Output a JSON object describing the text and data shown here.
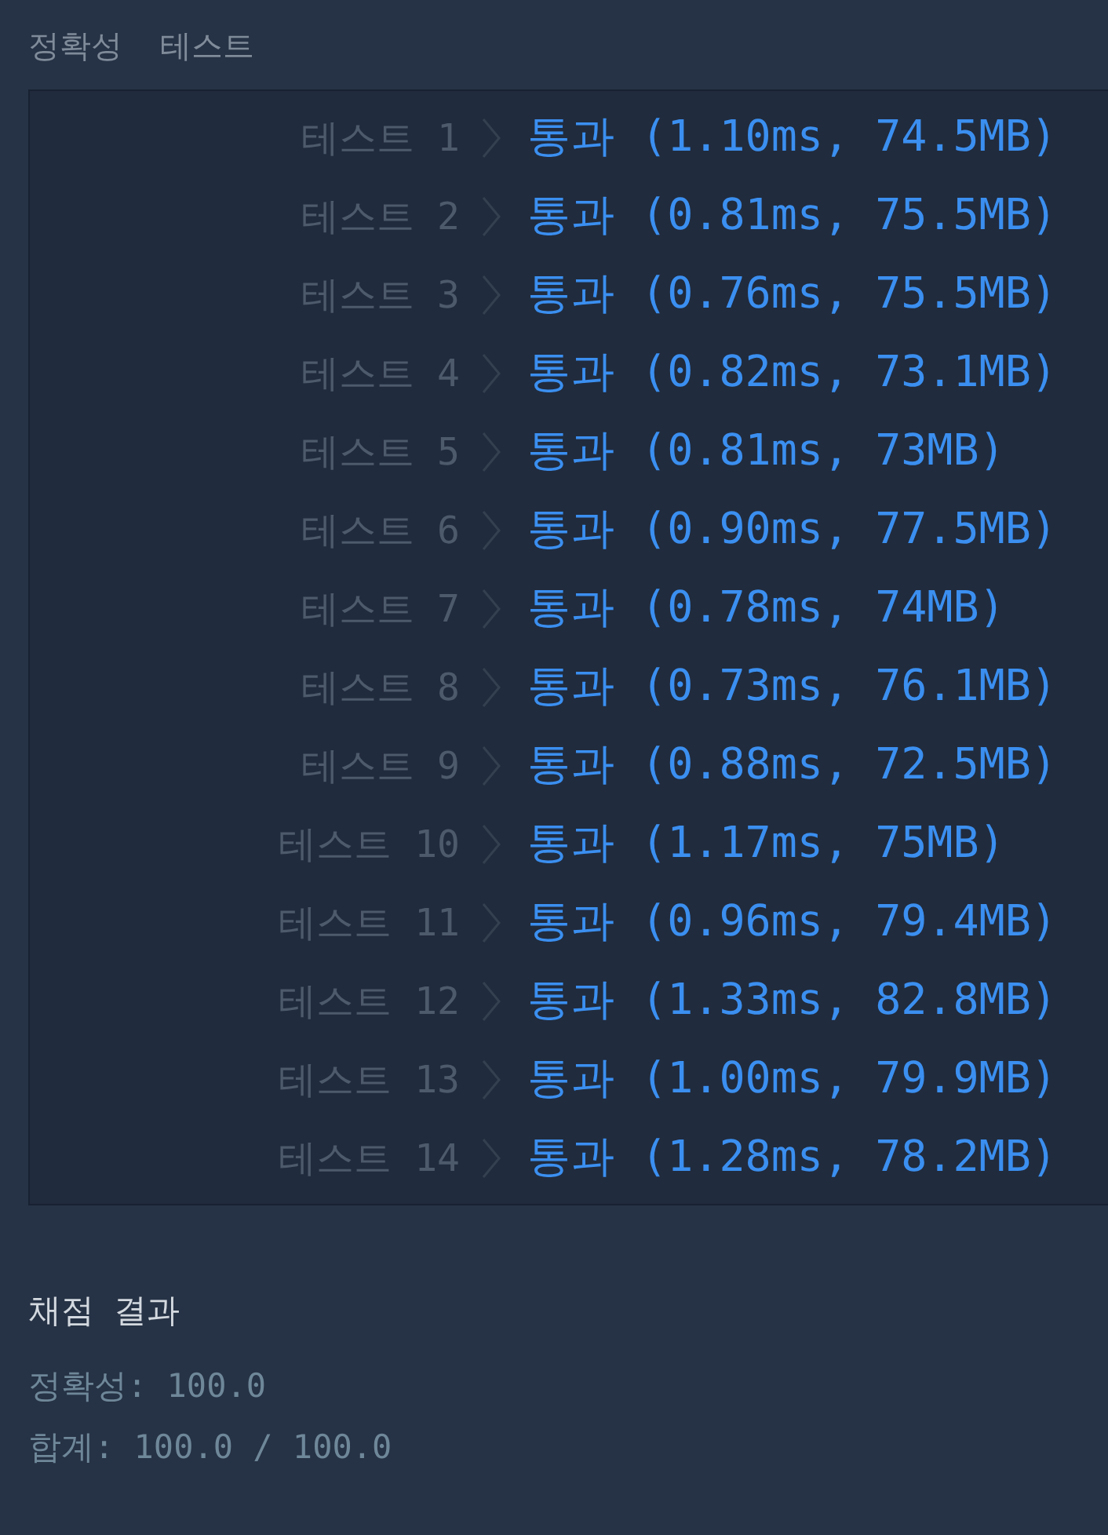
{
  "heading": {
    "category": "정확성",
    "label": "테스트"
  },
  "tests": [
    {
      "label": "테스트 1",
      "result": "통과 (1.10ms, 74.5MB)"
    },
    {
      "label": "테스트 2",
      "result": "통과 (0.81ms, 75.5MB)"
    },
    {
      "label": "테스트 3",
      "result": "통과 (0.76ms, 75.5MB)"
    },
    {
      "label": "테스트 4",
      "result": "통과 (0.82ms, 73.1MB)"
    },
    {
      "label": "테스트 5",
      "result": "통과 (0.81ms, 73MB)"
    },
    {
      "label": "테스트 6",
      "result": "통과 (0.90ms, 77.5MB)"
    },
    {
      "label": "테스트 7",
      "result": "통과 (0.78ms, 74MB)"
    },
    {
      "label": "테스트 8",
      "result": "통과 (0.73ms, 76.1MB)"
    },
    {
      "label": "테스트 9",
      "result": "통과 (0.88ms, 72.5MB)"
    },
    {
      "label": "테스트 10",
      "result": "통과 (1.17ms, 75MB)"
    },
    {
      "label": "테스트 11",
      "result": "통과 (0.96ms, 79.4MB)"
    },
    {
      "label": "테스트 12",
      "result": "통과 (1.33ms, 82.8MB)"
    },
    {
      "label": "테스트 13",
      "result": "통과 (1.00ms, 79.9MB)"
    },
    {
      "label": "테스트 14",
      "result": "통과 (1.28ms, 78.2MB)"
    }
  ],
  "summary": {
    "title": "채점 결과",
    "lines": [
      "정확성: 100.0",
      "합계: 100.0 / 100.0"
    ]
  }
}
